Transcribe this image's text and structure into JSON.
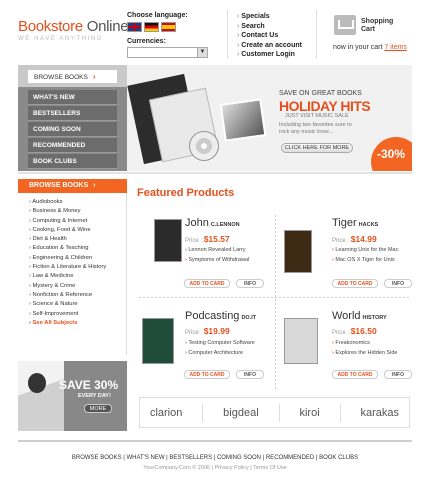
{
  "header": {
    "logo_main": "Bookstore",
    "logo_sub": "Online",
    "tagline": "WE HAVE ANYTHING",
    "language_label": "Choose language:",
    "currencies_label": "Currencies:",
    "currency_value": "",
    "links": [
      "Specials",
      "Search",
      "Contact Us",
      "Create an account",
      "Customer Login"
    ],
    "cart_title_1": "Shopping",
    "cart_title_2": "Cart",
    "cart_prefix": "now in your cart",
    "cart_count": "7 items"
  },
  "nav": {
    "top": "BROWSE BOOKS",
    "items": [
      "WHAT'S NEW",
      "BESTSELLERS",
      "COMING SOON",
      "RECOMMENDED",
      "BOOK CLUBS"
    ]
  },
  "hero": {
    "line1": "SAVE ON GREAT BOOKS",
    "line2": "HOLIDAY HITS",
    "line3": "JUST VISIT MUSIC SALE",
    "line4": "Including two favorites sure to rock any music lover...",
    "button": "CLICK HERE FOR MORE",
    "discount": "-30%"
  },
  "browse": {
    "title": "BROWSE BOOKS",
    "items": [
      "Audiobooks",
      "Business & Money",
      "Computing & Internet",
      "Cooking, Food & Wine",
      "Diet & Health",
      "Education & Teaching",
      "Engineering & Children",
      "Fiction & Literature & History",
      "Law & Medicine",
      "Mystery & Crime",
      "Nonfiction & Reference",
      "Science & Nature",
      "Self-Improvement"
    ],
    "all": "See All Subjects"
  },
  "promo": {
    "title": "SAVE 30%",
    "sub": "EVERY DAY!",
    "button": "MORE"
  },
  "featured": {
    "title": "Featured Products",
    "price_label": "Price :",
    "add_label": "ADD TO CARD",
    "info_label": "INFO",
    "products": [
      {
        "title": "John",
        "suffix": "C.LENNON",
        "price": "$15.57",
        "bullets": [
          "Lennon Revealed Larry",
          "Symptoms of Withdrawal"
        ],
        "cover": "#2b2b2b"
      },
      {
        "title": "Tiger",
        "suffix": "HACKS",
        "price": "$14.99",
        "bullets": [
          "Learning Unix for the Mac",
          "Mac OS X Tiger for Unix"
        ],
        "cover": "#3d2a14"
      },
      {
        "title": "Podcasting",
        "suffix": "DO.IT",
        "price": "$19.99",
        "bullets": [
          "Testing Computer Software",
          "Computer Architecture"
        ],
        "cover": "#1f4d3a"
      },
      {
        "title": "World",
        "suffix": "HISTORY",
        "price": "$16.50",
        "bullets": [
          "Freakonomics",
          "Explores the Hidden Side"
        ],
        "cover": "#d9d9d9"
      }
    ]
  },
  "brands": [
    "clarion",
    "bigdeal",
    "kiroi",
    "karakas"
  ],
  "footer": {
    "links": "BROWSE BOOKS | WHAT'S NEW | BESTSELLERS | COMING SOON | RECOMMENDED | BOOK CLUBS",
    "copy": "YourCompany.Com © 2006 | Privacy Policy | Terms Of Use"
  },
  "colors": {
    "accent": "#f26522",
    "nav_bg": "#8a8a8a",
    "nav_item": "#6c6c6c"
  }
}
